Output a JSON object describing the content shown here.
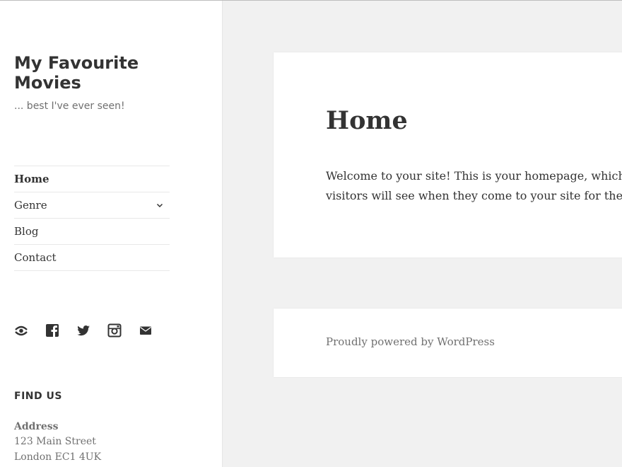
{
  "site": {
    "title": "My Favourite Movies",
    "description": "... best I've ever seen!"
  },
  "nav": {
    "items": [
      {
        "label": "Home",
        "current": true
      },
      {
        "label": "Genre",
        "has_submenu": true
      },
      {
        "label": "Blog"
      },
      {
        "label": "Contact"
      }
    ]
  },
  "social": {
    "icons": [
      "link-icon",
      "facebook-icon",
      "twitter-icon",
      "instagram-icon",
      "email-icon"
    ]
  },
  "widget": {
    "title": "FIND US",
    "address_label": "Address",
    "address_lines": [
      "123 Main Street",
      "London EC1 4UK"
    ]
  },
  "page": {
    "title": "Home",
    "content_lines": [
      "Welcome to your site! This is your homepage, which",
      "visitors will see when they come to your site for the"
    ]
  },
  "footer": {
    "credit": "Proudly powered by WordPress"
  },
  "colors": {
    "background": "#f1f1f1",
    "panel": "#ffffff",
    "text": "#333333",
    "muted_text": "#707070"
  }
}
